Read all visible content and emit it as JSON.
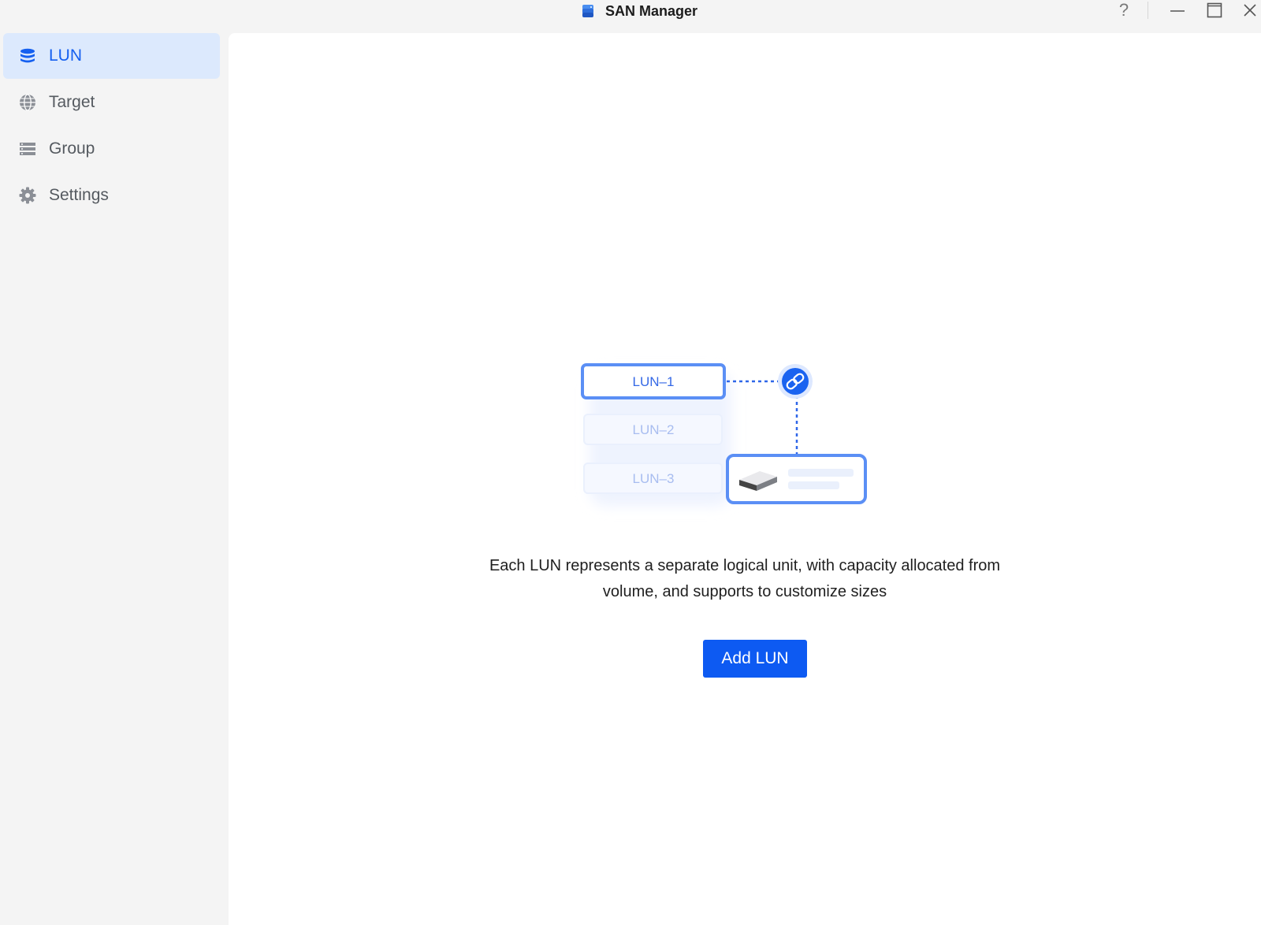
{
  "window": {
    "title": "SAN Manager",
    "help_label": "?"
  },
  "sidebar": {
    "items": [
      {
        "label": "LUN",
        "icon": "database-icon",
        "active": true
      },
      {
        "label": "Target",
        "icon": "globe-icon",
        "active": false
      },
      {
        "label": "Group",
        "icon": "list-icon",
        "active": false
      },
      {
        "label": "Settings",
        "icon": "gear-icon",
        "active": false
      }
    ]
  },
  "illustration": {
    "luns": [
      "LUN–1",
      "LUN–2",
      "LUN–3"
    ]
  },
  "main": {
    "description_line1": "Each LUN represents a separate logical unit, with capacity allocated from",
    "description_line2": "volume, and supports to customize sizes",
    "add_button_label": "Add LUN"
  },
  "colors": {
    "accent": "#0d5af2",
    "active_nav_bg": "#dce9fd",
    "active_nav_text": "#1560f0",
    "sidebar_bg": "#f4f4f4",
    "content_bg": "#ffffff"
  }
}
